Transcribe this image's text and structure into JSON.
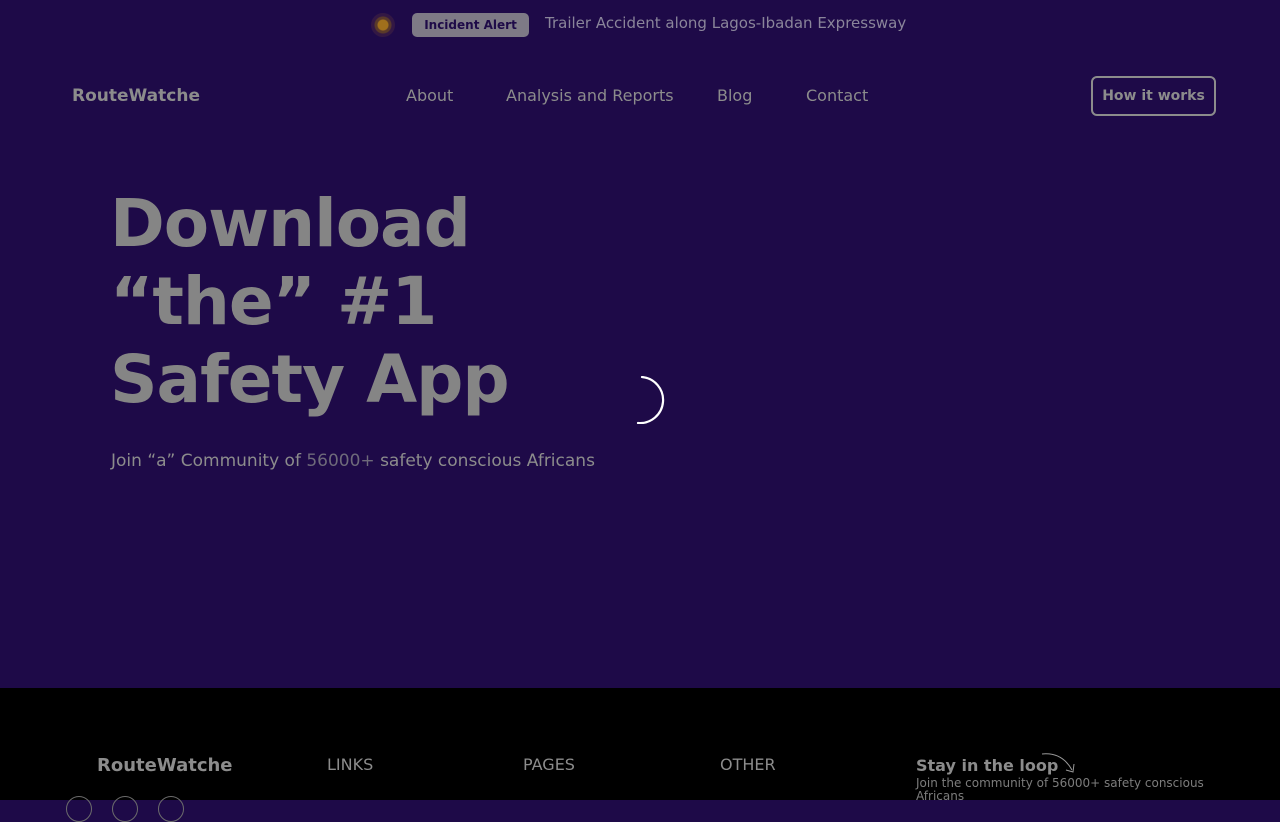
{
  "alert": {
    "badge": "Incident Alert",
    "text": "Trailer Accident along Lagos-Ibadan Expressway"
  },
  "nav": {
    "logo": "RouteWatche",
    "links": [
      "About",
      "Analysis and Reports",
      "Blog",
      "Contact"
    ],
    "cta": "How it works"
  },
  "hero": {
    "title_lines": [
      "Download",
      "“the” #1",
      "Safety App"
    ],
    "subtitle_prefix": "Join “a” Community of ",
    "subtitle_count": "56000+",
    "subtitle_suffix": " safety conscious Africans"
  },
  "footer": {
    "logo": "RouteWatche",
    "headings": [
      "LINKS",
      "PAGES",
      "OTHER"
    ],
    "newsletter_title": "Stay in the loop",
    "newsletter_text": "Join the community of 56000+ safety conscious Africans"
  },
  "icons": {
    "alert": "pulse-dot-icon",
    "loading": "loading-spinner-icon",
    "arrow": "curved-arrow-icon",
    "social": [
      "social-icon",
      "social-icon",
      "social-icon"
    ]
  }
}
